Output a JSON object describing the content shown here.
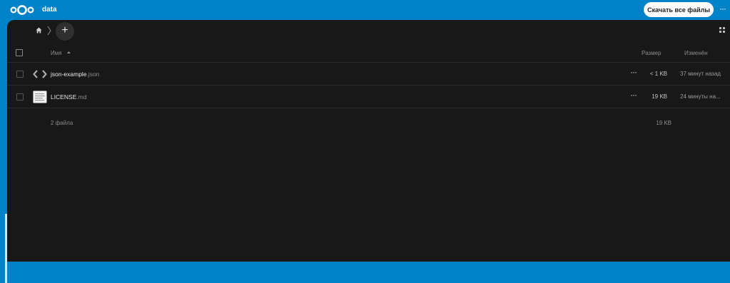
{
  "header": {
    "app_title": "data",
    "download_label": "Скачать все файлы",
    "more_label": "···"
  },
  "breadcrumb": {
    "add_label": "+"
  },
  "table": {
    "columns": {
      "name": "Имя",
      "size": "Размер",
      "modified": "Изменён"
    },
    "rows": [
      {
        "base": "json-example",
        "ext": ".json",
        "size": "< 1 KB",
        "modified": "37 минут назад",
        "icon": "code-file-icon",
        "more": "···"
      },
      {
        "base": "LICENSE",
        "ext": ".md",
        "size": "19 KB",
        "modified": "24 минуты на...",
        "icon": "text-file-icon",
        "more": "···"
      }
    ],
    "summary": {
      "count": "2 файла",
      "size": "19 KB"
    }
  },
  "colors": {
    "accent": "#0082c9",
    "background": "#181818"
  }
}
